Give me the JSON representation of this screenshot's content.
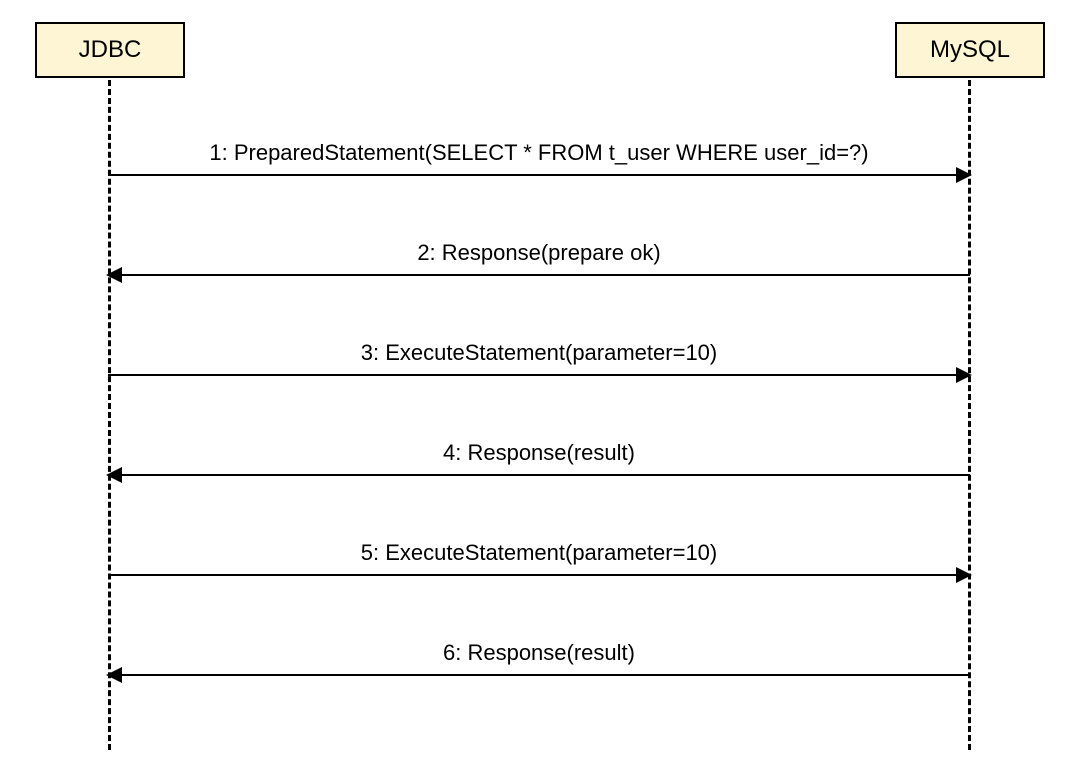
{
  "participants": {
    "left": "JDBC",
    "right": "MySQL"
  },
  "messages": [
    {
      "label": "1:  PreparedStatement(SELECT * FROM t_user WHERE user_id=?)",
      "direction": "right"
    },
    {
      "label": "2:  Response(prepare ok)",
      "direction": "left"
    },
    {
      "label": "3:  ExecuteStatement(parameter=10)",
      "direction": "right"
    },
    {
      "label": "4:  Response(result)",
      "direction": "left"
    },
    {
      "label": "5:  ExecuteStatement(parameter=10)",
      "direction": "right"
    },
    {
      "label": "6:  Response(result)",
      "direction": "left"
    }
  ],
  "chart_data": {
    "type": "sequence-diagram",
    "participants": [
      "JDBC",
      "MySQL"
    ],
    "interactions": [
      {
        "from": "JDBC",
        "to": "MySQL",
        "message": "PreparedStatement(SELECT * FROM t_user WHERE user_id=?)",
        "step": 1
      },
      {
        "from": "MySQL",
        "to": "JDBC",
        "message": "Response(prepare ok)",
        "step": 2
      },
      {
        "from": "JDBC",
        "to": "MySQL",
        "message": "ExecuteStatement(parameter=10)",
        "step": 3
      },
      {
        "from": "MySQL",
        "to": "JDBC",
        "message": "Response(result)",
        "step": 4
      },
      {
        "from": "JDBC",
        "to": "MySQL",
        "message": "ExecuteStatement(parameter=10)",
        "step": 5
      },
      {
        "from": "MySQL",
        "to": "JDBC",
        "message": "Response(result)",
        "step": 6
      }
    ]
  }
}
